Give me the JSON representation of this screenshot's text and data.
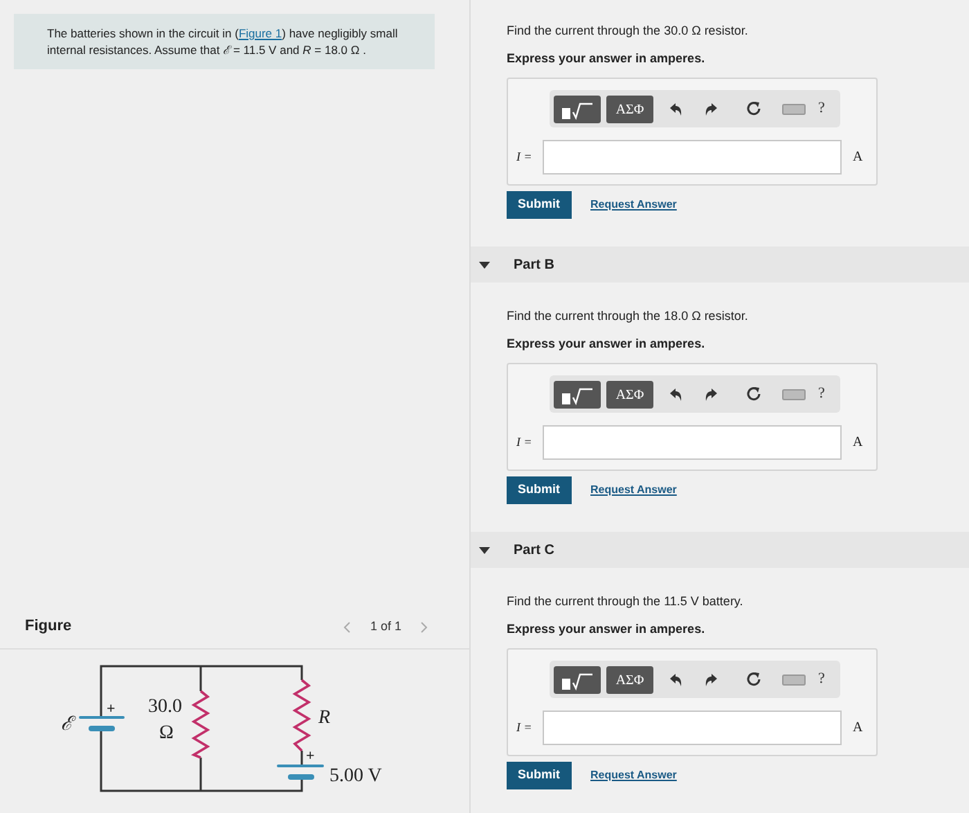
{
  "intro": {
    "before": "The batteries shown in the circuit in (",
    "link": "Figure 1",
    "after": ") have negligibly small internal resistances. Assume that *ℰ* = 11.5 V and *R* = 18.0 Ω ."
  },
  "figure": {
    "title": "Figure",
    "pager": "1 of 1",
    "emf": "ℰ",
    "plus_signs": [
      "+",
      "+"
    ],
    "resistor_value": "30.0",
    "resistor_unit": "Ω",
    "resistor_name": "R",
    "battery_label": "5.00 V"
  },
  "parts": [
    {
      "prompt": "Find the current through the 30.0 Ω resistor.",
      "instruction": "Express your answer in amperes.",
      "greek": "ΑΣΦ",
      "help": "?",
      "variable": "I =",
      "unit": "A",
      "submit": "Submit",
      "request": "Request Answer"
    },
    {
      "title": "Part B",
      "expanded": true,
      "prompt": "Find the current through the 18.0 Ω resistor.",
      "instruction": "Express your answer in amperes.",
      "greek": "ΑΣΦ",
      "help": "?",
      "variable": "I =",
      "unit": "A",
      "submit": "Submit",
      "request": "Request Answer"
    },
    {
      "title": "Part C",
      "expanded": true,
      "prompt": "Find the current through the 11.5 V battery.",
      "instruction": "Express your answer in amperes.",
      "greek": "ΑΣΦ",
      "help": "?",
      "variable": "I =",
      "unit": "A",
      "submit": "Submit",
      "request": "Request Answer"
    }
  ]
}
